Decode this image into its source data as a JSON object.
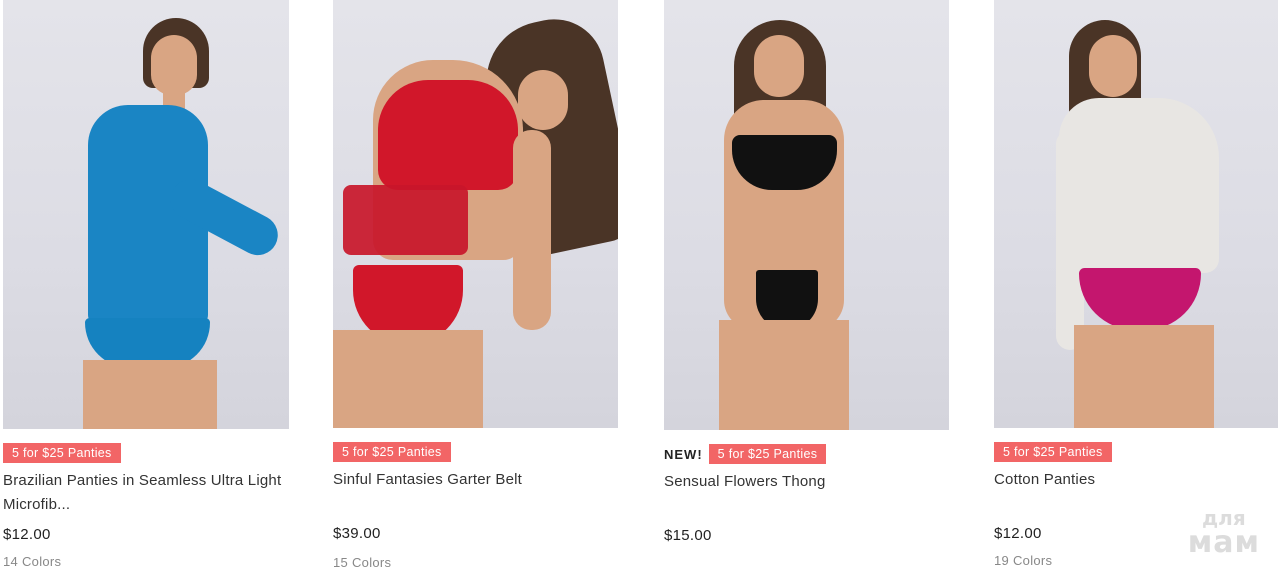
{
  "products": [
    {
      "badge_new": "",
      "promo": "5 for $25 Panties",
      "name_line1": "Brazilian Panties in Seamless Ultra Light",
      "name_line2": "Microfib...",
      "price": "$12.00",
      "colors": "14 Colors",
      "garment_color": "#1a85c4"
    },
    {
      "badge_new": "",
      "promo": "5 for $25 Panties",
      "name_line1": "Sinful Fantasies Garter Belt",
      "name_line2": "",
      "price": "$39.00",
      "colors": "15 Colors",
      "garment_color": "#d1172a"
    },
    {
      "badge_new": "NEW!",
      "promo": "5 for $25 Panties",
      "name_line1": "Sensual Flowers Thong",
      "name_line2": "",
      "price": "$15.00",
      "colors": "",
      "garment_color": "#111111"
    },
    {
      "badge_new": "",
      "promo": "5 for $25 Panties",
      "name_line1": "Cotton Panties",
      "name_line2": "",
      "price": "$12.00",
      "colors": "19 Colors",
      "garment_color": "#c4166e"
    }
  ],
  "watermark": {
    "line1": "для",
    "line2": "мам"
  },
  "colors": {
    "promo_bg": "#f26566",
    "price": "#222222",
    "muted": "#888888"
  }
}
